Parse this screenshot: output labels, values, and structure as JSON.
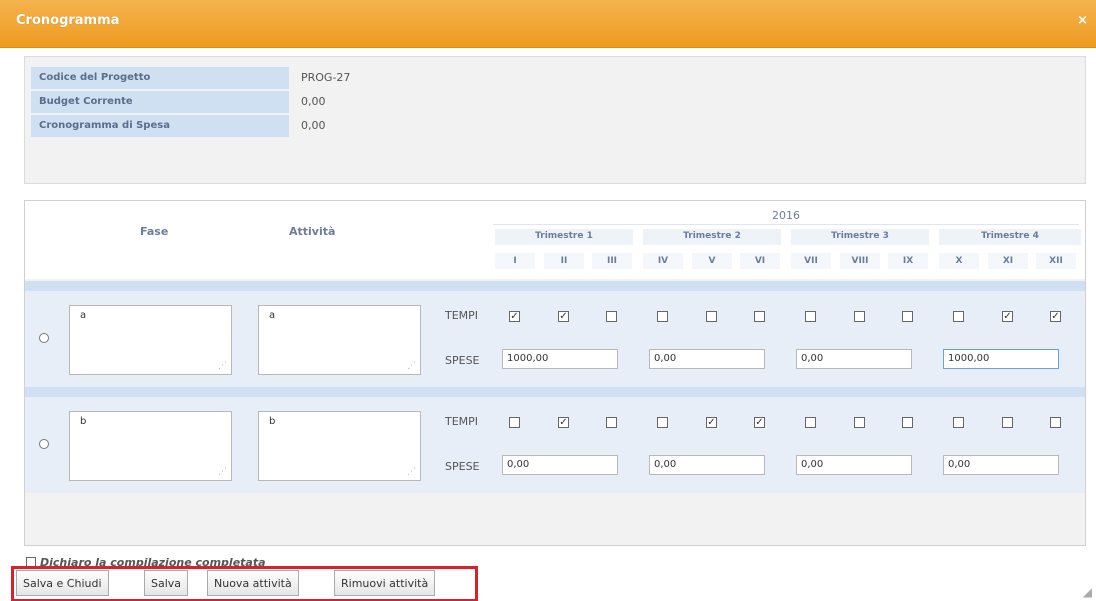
{
  "window": {
    "title": "Cronogramma",
    "close_symbol": "×"
  },
  "info": {
    "rows": [
      {
        "label": "Codice del Progetto",
        "value": "PROG-27"
      },
      {
        "label": "Budget Corrente",
        "value": "0,00"
      },
      {
        "label": "Cronogramma di Spesa",
        "value": "0,00"
      }
    ]
  },
  "grid": {
    "col_fase": "Fase",
    "col_attivita": "Attività",
    "year": "2016",
    "quarters": [
      "Trimestre 1",
      "Trimestre 2",
      "Trimestre 3",
      "Trimestre 4"
    ],
    "months": [
      "I",
      "II",
      "III",
      "IV",
      "V",
      "VI",
      "VII",
      "VIII",
      "IX",
      "X",
      "XI",
      "XII"
    ],
    "tempi_label": "TEMPI",
    "spese_label": "SPESE",
    "rows": [
      {
        "fase": "a",
        "attivita": "a",
        "tempi": [
          true,
          true,
          false,
          false,
          false,
          false,
          false,
          false,
          false,
          false,
          true,
          true
        ],
        "spese": [
          "1000,00",
          "0,00",
          "0,00",
          "1000,00"
        ]
      },
      {
        "fase": "b",
        "attivita": "b",
        "tempi": [
          false,
          true,
          false,
          false,
          true,
          true,
          false,
          false,
          false,
          false,
          false,
          false
        ],
        "spese": [
          "0,00",
          "0,00",
          "0,00",
          "0,00"
        ]
      }
    ]
  },
  "footer": {
    "declaration": "Dichiaro la compilazione completata",
    "buttons": {
      "save_close": "Salva e Chiudi",
      "save": "Salva",
      "new_activity": "Nuova attività",
      "remove_activity": "Rimuovi attività"
    }
  },
  "colors": {
    "titlebar": "#ee9a20",
    "label_bg": "#cfe0f3",
    "row_bg": "#e8eef8",
    "highlight": "#d9202b"
  }
}
